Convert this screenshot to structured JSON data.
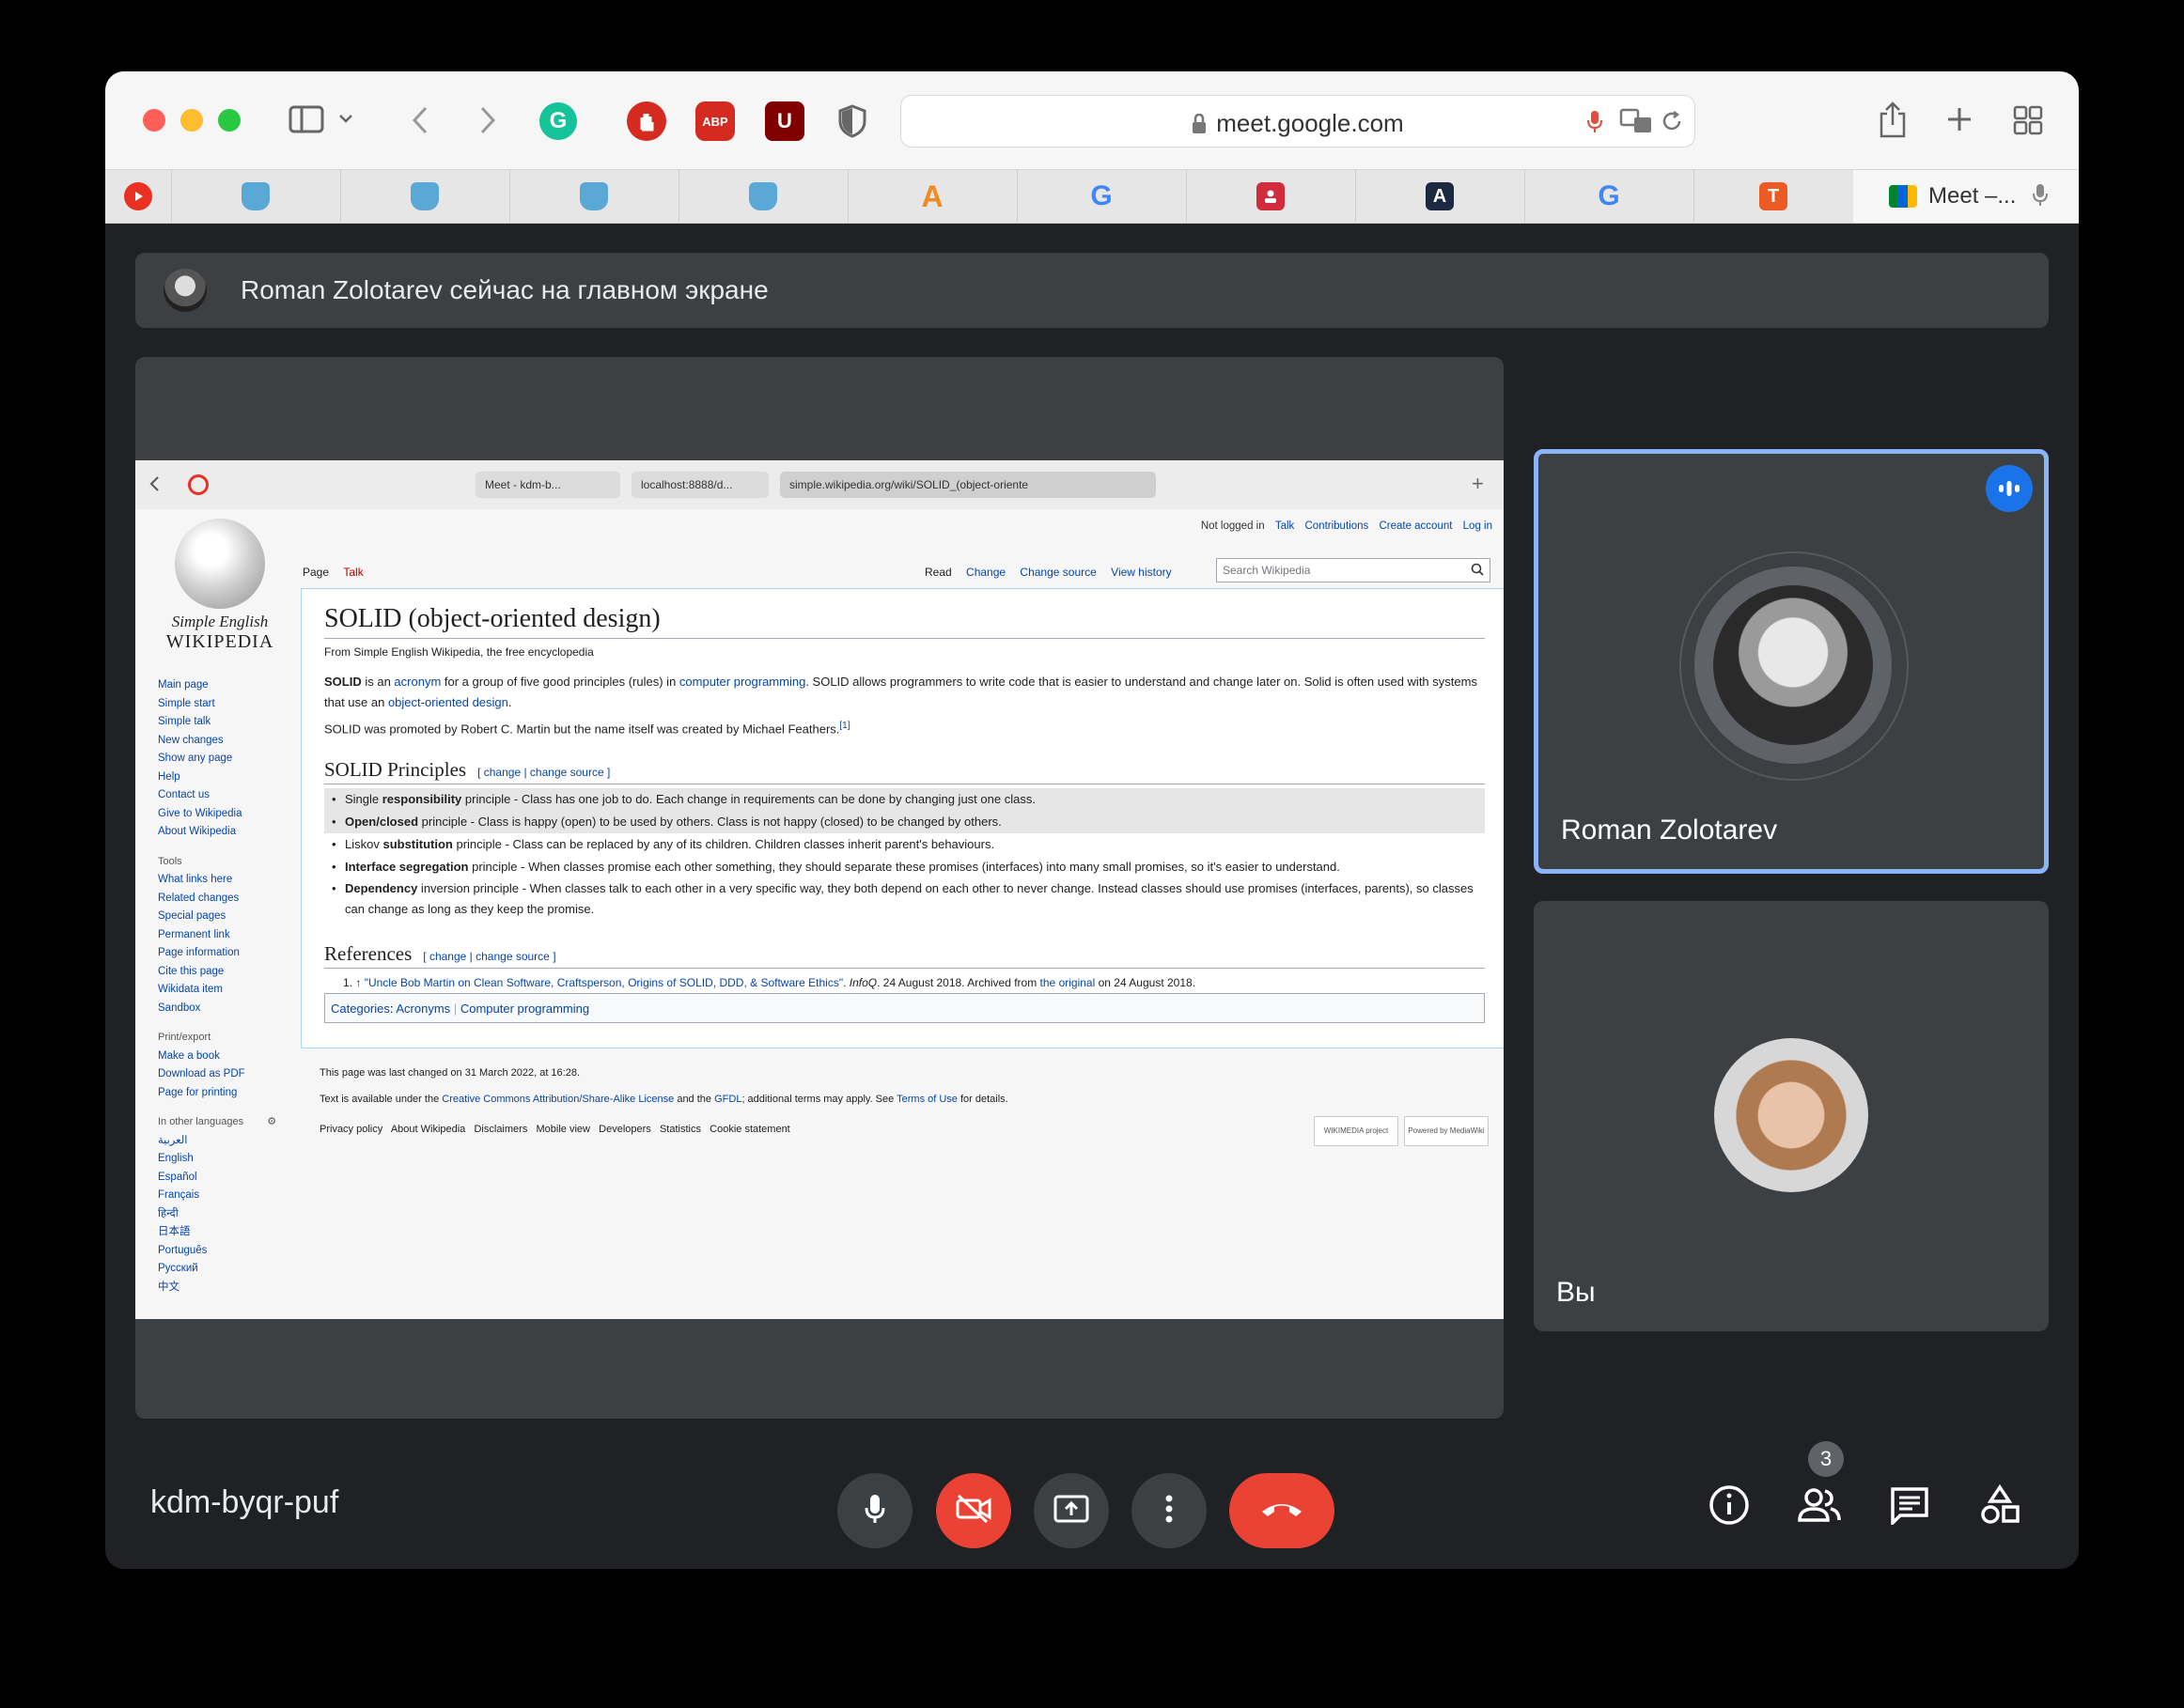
{
  "browser": {
    "url": "meet.google.com",
    "active_tab_title": "Meet –...",
    "pinned_tabs": [
      {
        "icon": "youtube-music-icon",
        "letter": ""
      },
      {
        "icon": "cat-icon-1",
        "letter": ""
      },
      {
        "icon": "cat-icon-2",
        "letter": ""
      },
      {
        "icon": "cat-icon-3",
        "letter": ""
      },
      {
        "icon": "cat-icon-4",
        "letter": ""
      },
      {
        "icon": "a-letter-icon",
        "letter": "A"
      },
      {
        "icon": "google-icon",
        "letter": "G"
      },
      {
        "icon": "contact-card-icon",
        "letter": ""
      },
      {
        "icon": "a-triangle-icon",
        "letter": "A"
      },
      {
        "icon": "google-icon-2",
        "letter": "G"
      },
      {
        "icon": "t-letter-icon",
        "letter": "T"
      }
    ],
    "extensions": {
      "grammarly": "G",
      "adblock": "ABP",
      "ublock": "U"
    }
  },
  "meet": {
    "banner_text": "Roman Zolotarev сейчас на главном экране",
    "meeting_code": "kdm-byqr-puf",
    "participants": [
      {
        "name": "Roman Zolotarev",
        "speaking": true
      },
      {
        "name": "Вы",
        "speaking": false
      }
    ],
    "participant_count": "3"
  },
  "shared_screen": {
    "tabs": [
      "Meet - kdm-b...",
      "localhost:8888/d...",
      "simple.wikipedia.org/wiki/SOLID_(object-oriente"
    ],
    "wiki": {
      "logo_line1": "Simple English",
      "logo_line2": "WIKIPEDIA",
      "top_links": {
        "not_logged": "Not logged in",
        "talk": "Talk",
        "contributions": "Contributions",
        "create": "Create account",
        "login": "Log in"
      },
      "page_tab": "Page",
      "talk_tab": "Talk",
      "view_tabs": [
        "Read",
        "Change",
        "Change source",
        "View history"
      ],
      "search_placeholder": "Search Wikipedia",
      "nav_links": [
        "Main page",
        "Simple start",
        "Simple talk",
        "New changes",
        "Show any page",
        "Help",
        "Contact us",
        "Give to Wikipedia",
        "About Wikipedia"
      ],
      "tools_heading": "Tools",
      "tools_links": [
        "What links here",
        "Related changes",
        "Special pages",
        "Permanent link",
        "Page information",
        "Cite this page",
        "Wikidata item",
        "Sandbox"
      ],
      "print_heading": "Print/export",
      "print_links": [
        "Make a book",
        "Download as PDF",
        "Page for printing"
      ],
      "lang_heading": "In other languages",
      "lang_links": [
        "العربية",
        "English",
        "Español",
        "Français",
        "हिन्दी",
        "日本語",
        "Português",
        "Русский",
        "中文"
      ],
      "title": "SOLID (object-oriented design)",
      "subtitle": "From Simple English Wikipedia, the free encyclopedia",
      "intro": {
        "solid": "SOLID",
        "is_an": " is an ",
        "acronym": "acronym",
        "for_group": " for a group of five good principles (rules) in ",
        "comp_prog": "computer programming",
        "rest": ". SOLID allows programmers to write code that is easier to understand and change later on. Solid is often used with systems that use an ",
        "ood": "object-oriented design",
        "end": "."
      },
      "promoted": "SOLID was promoted by Robert C. Martin but the name itself was created by Michael Feathers.",
      "promoted_ref": "[1]",
      "h2_principles": "SOLID Principles",
      "edit_change": "change",
      "edit_sep": " | ",
      "edit_source": "change source",
      "edit_open": "[ ",
      "edit_close": " ]",
      "principles": [
        {
          "pre": "Single ",
          "bold": "responsibility",
          "rest": " principle - Class has one job to do. Each change in requirements can be done by changing just one class."
        },
        {
          "pre": "",
          "bold": "Open/closed",
          "rest": " principle - Class is happy (open) to be used by others. Class is not happy (closed) to be changed by others."
        },
        {
          "pre": "Liskov ",
          "bold": "substitution",
          "rest": " principle - Class can be replaced by any of its children. Children classes inherit parent's behaviours."
        },
        {
          "pre": "",
          "bold": "Interface segregation",
          "rest": " principle - When classes promise each other something, they should separate these promises (interfaces) into many small promises, so it's easier to understand."
        },
        {
          "pre": "",
          "bold": "Dependency",
          "rest": " inversion principle - When classes talk to each other in a very specific way, they both depend on each other to never change. Instead classes should use promises (interfaces, parents), so classes can change as long as they keep the promise."
        }
      ],
      "h2_refs": "References",
      "ref": {
        "num": "1. ↑ ",
        "link": "\"Uncle Bob Martin on Clean Software, Craftsperson, Origins of SOLID, DDD, & Software Ethics\"",
        "infoq": "InfoQ",
        "date": ". 24 August 2018. Archived from ",
        "original": "the original",
        "end": " on 24 August 2018."
      },
      "categories_label": "Categories",
      "categories": [
        "Acronyms",
        "Computer programming"
      ],
      "last_changed": "This page was last changed on 31 March 2022, at 16:28.",
      "license_pre": "Text is available under the ",
      "license_link": "Creative Commons Attribution/Share-Alike License",
      "license_and": " and the ",
      "gfdl": "GFDL",
      "license_mid": "; additional terms may apply. See ",
      "terms": "Terms of Use",
      "license_end": " for details.",
      "footer_links": [
        "Privacy policy",
        "About Wikipedia",
        "Disclaimers",
        "Mobile view",
        "Developers",
        "Statistics",
        "Cookie statement"
      ],
      "badge_wikimedia": "WIKIMEDIA project",
      "badge_mediawiki": "Powered by MediaWiki"
    }
  },
  "colors": {
    "meet_bg": "#202124",
    "tile_bg": "#3c4043",
    "speaking_border": "#8ab4f8",
    "end_call": "#ea4335",
    "link": "#0645ad"
  }
}
